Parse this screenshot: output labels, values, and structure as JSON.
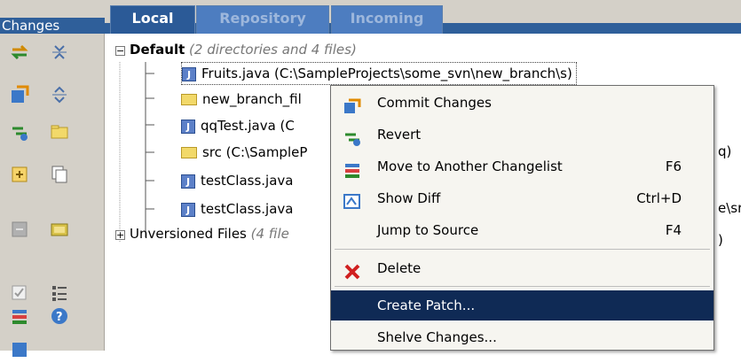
{
  "header": {
    "title": "Changes",
    "tabs": [
      "Local",
      "Repository",
      "Incoming"
    ]
  },
  "tree": {
    "default_name": "Default",
    "default_hint": "(2 directories and 4 files)",
    "items": [
      {
        "name": "Fruits.java (C:\\SampleProjects\\some_svn\\new_branch\\s)",
        "kind": "java"
      },
      {
        "name": "new_branch_fil",
        "kind": "folder"
      },
      {
        "name": "qqTest.java (C",
        "kind": "java",
        "tail": "q)"
      },
      {
        "name": "src (C:\\SampleP",
        "kind": "folder"
      },
      {
        "name": "testClass.java",
        "kind": "java",
        "tail": "e\\src"
      },
      {
        "name": "testClass.java",
        "kind": "java",
        "tail": ")"
      }
    ],
    "unversioned_name": "Unversioned Files",
    "unversioned_hint": "(4 file"
  },
  "menu": {
    "items": [
      {
        "label": "Commit Changes",
        "shortcut": "",
        "icon": "commit-icon"
      },
      {
        "label": "Revert",
        "shortcut": "",
        "icon": "revert-icon"
      },
      {
        "label": "Move to Another Changelist",
        "shortcut": "F6",
        "icon": "move-changelist-icon"
      },
      {
        "label": "Show Diff",
        "shortcut": "Ctrl+D",
        "icon": "diff-icon"
      },
      {
        "label": "Jump to Source",
        "shortcut": "F4",
        "icon": ""
      },
      {
        "label": "Delete",
        "shortcut": "",
        "icon": "delete-icon"
      },
      {
        "label": "Create Patch...",
        "shortcut": "",
        "icon": ""
      },
      {
        "label": "Shelve Changes...",
        "shortcut": "",
        "icon": ""
      }
    ],
    "selected": "Create Patch..."
  },
  "colors": {
    "accent": "#2f5f9a",
    "menu_selection": "#0f2a55",
    "toolbar_bg": "#d4d0c8"
  }
}
